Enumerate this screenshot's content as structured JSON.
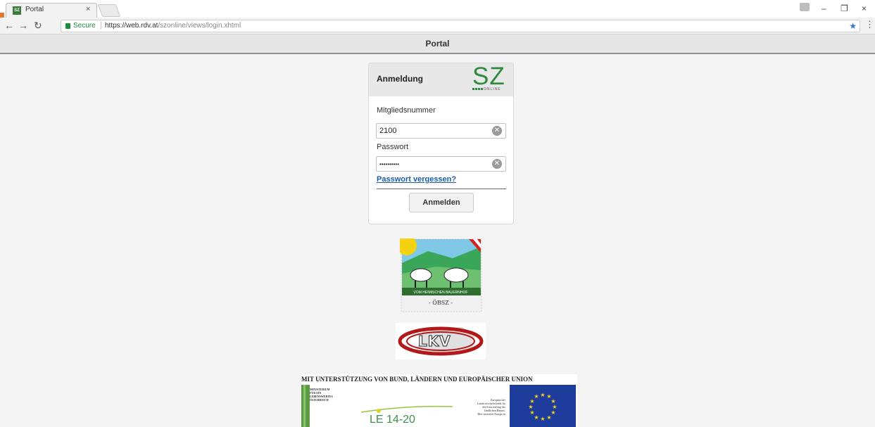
{
  "browser": {
    "tab_title": "Portal",
    "tab_close": "×",
    "secure_label": "Secure",
    "url_host": "https://web.rdv.at",
    "url_path": "/szonline/views/login.xhtml",
    "window_controls": [
      "–",
      "❐",
      "×"
    ]
  },
  "page": {
    "header_title": "Portal"
  },
  "login": {
    "title": "Anmeldung",
    "logo_text": "SZ",
    "logo_subtext": "ONLINE",
    "member_label": "Mitgliedsnummer",
    "member_value": "2100",
    "password_label": "Passwort",
    "password_value": "••••••••••",
    "forgot_link": "Passwort vergessen?",
    "submit_label": "Anmelden"
  },
  "logos": {
    "oebsz_caption": "VOM HEIMISCHEN BAUERNHOF",
    "oebsz_name": "- ÖBSZ -",
    "lkv_text": "LKV",
    "eu_title": "MIT UNTERSTÜTZUNG VON BUND, LÄNDERN UND EUROPÄISCHER UNION",
    "ministry_lines": [
      "MINISTERIUM",
      "FÜR EIN",
      "LEBENSWERTES",
      "ÖSTERREICH"
    ],
    "le_text": "LE 14-20",
    "eafrd_lines": [
      "Europäischer",
      "Landwirtschaftsfonds für",
      "die Entwicklung des",
      "ländlichen Raums:",
      "Hier investiert Europa in"
    ]
  },
  "colors": {
    "accent_green": "#2f8a3e",
    "link_blue": "#1a5fa8",
    "eu_blue": "#1d3c9c",
    "eu_star": "#f7d21e"
  }
}
